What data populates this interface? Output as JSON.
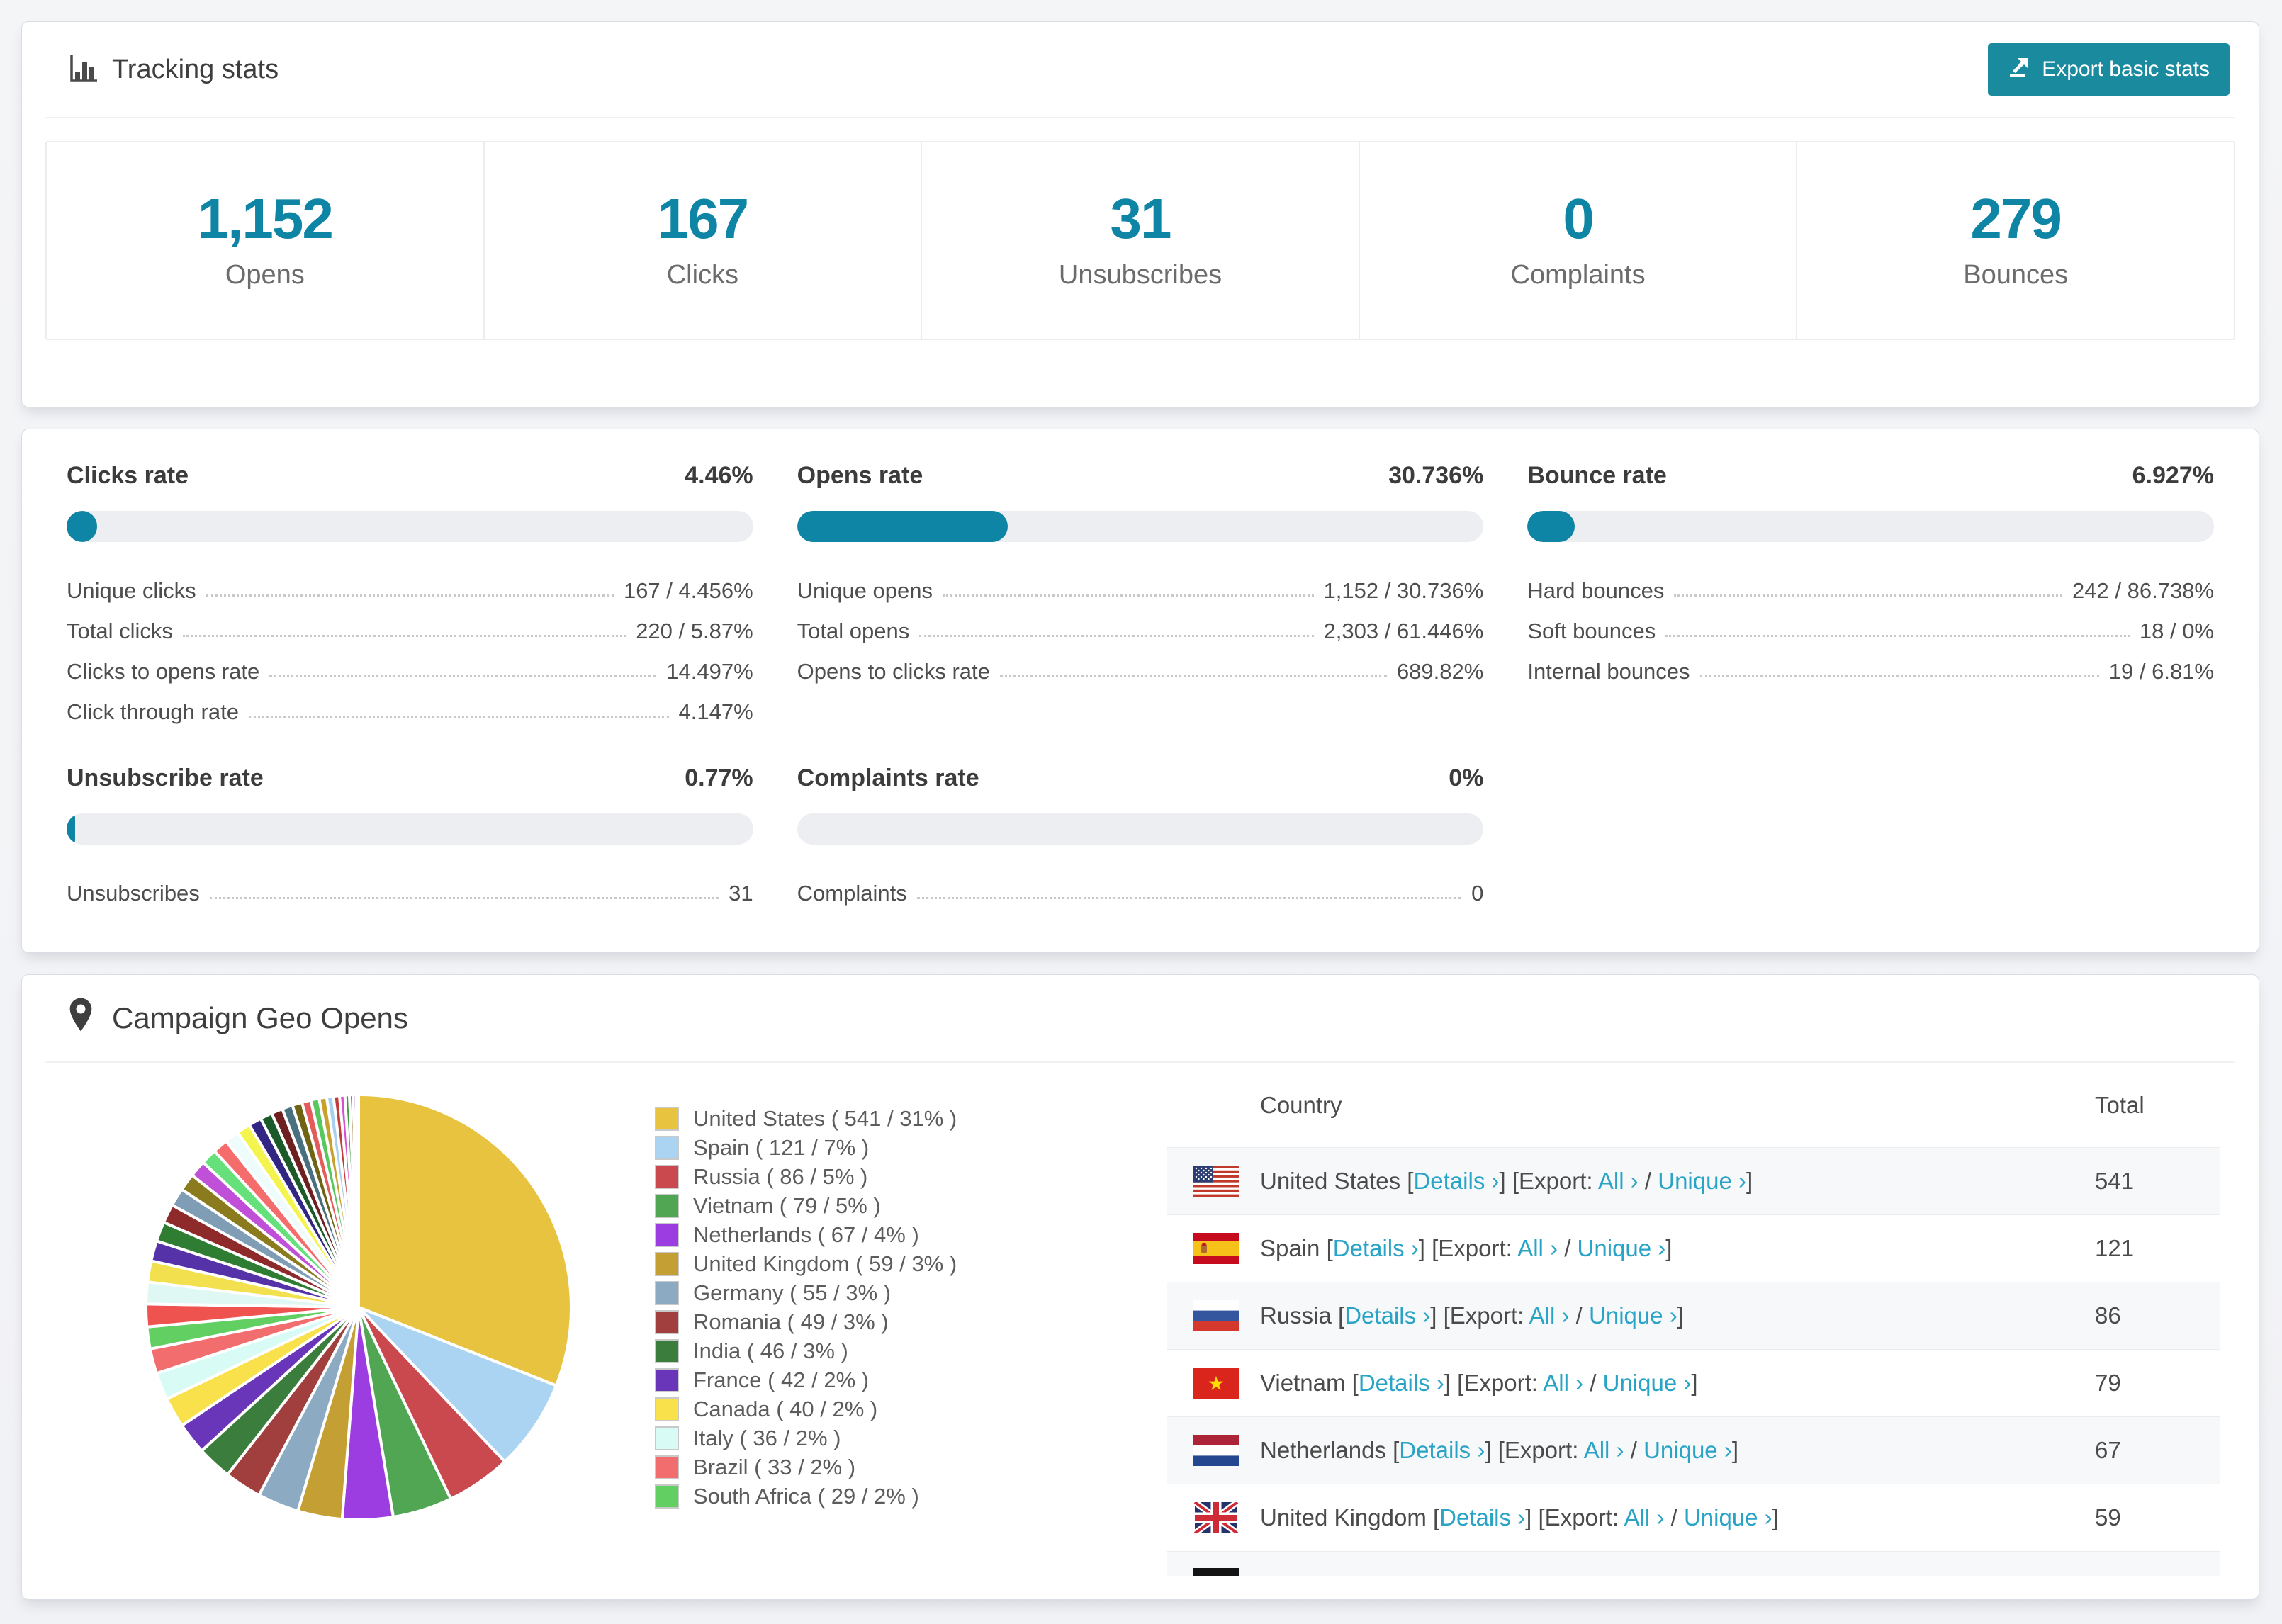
{
  "colors": {
    "accent": "#0f85a6",
    "button": "#1a8a9f",
    "link": "#29a3c6",
    "bar_track": "#eceef1",
    "zebra": "#f7f8f9"
  },
  "tracking": {
    "title": "Tracking stats",
    "export_button": "Export basic stats",
    "stats": [
      {
        "value": "1,152",
        "label": "Opens"
      },
      {
        "value": "167",
        "label": "Clicks"
      },
      {
        "value": "31",
        "label": "Unsubscribes"
      },
      {
        "value": "0",
        "label": "Complaints"
      },
      {
        "value": "279",
        "label": "Bounces"
      }
    ]
  },
  "rates": [
    {
      "title": "Clicks rate",
      "value": "4.46%",
      "percent": 4.46,
      "rows": [
        {
          "label": "Unique clicks",
          "value": "167 / 4.456%"
        },
        {
          "label": "Total clicks",
          "value": "220 / 5.87%"
        },
        {
          "label": "Clicks to opens rate",
          "value": "14.497%"
        },
        {
          "label": "Click through rate",
          "value": "4.147%"
        }
      ]
    },
    {
      "title": "Opens rate",
      "value": "30.736%",
      "percent": 30.736,
      "rows": [
        {
          "label": "Unique opens",
          "value": "1,152 / 30.736%"
        },
        {
          "label": "Total opens",
          "value": "2,303 / 61.446%"
        },
        {
          "label": "Opens to clicks rate",
          "value": "689.82%"
        }
      ]
    },
    {
      "title": "Bounce rate",
      "value": "6.927%",
      "percent": 6.927,
      "rows": [
        {
          "label": "Hard bounces",
          "value": "242 / 86.738%"
        },
        {
          "label": "Soft bounces",
          "value": "18 / 0%"
        },
        {
          "label": "Internal bounces",
          "value": "19 / 6.81%"
        }
      ]
    },
    {
      "title": "Unsubscribe rate",
      "value": "0.77%",
      "percent": 0.77,
      "rows": [
        {
          "label": "Unsubscribes",
          "value": "31"
        }
      ]
    },
    {
      "title": "Complaints rate",
      "value": "0%",
      "percent": 0,
      "rows": [
        {
          "label": "Complaints",
          "value": "0"
        }
      ]
    }
  ],
  "geo": {
    "title": "Campaign Geo Opens",
    "table": {
      "columns": [
        "Country",
        "Total"
      ],
      "link_labels": {
        "details": "Details ›",
        "export": "Export:",
        "all": "All ›",
        "unique": "Unique ›"
      },
      "rows": [
        {
          "flag": "us",
          "country": "United States",
          "total": "541"
        },
        {
          "flag": "es",
          "country": "Spain",
          "total": "121"
        },
        {
          "flag": "ru",
          "country": "Russia",
          "total": "86"
        },
        {
          "flag": "vn",
          "country": "Vietnam",
          "total": "79"
        },
        {
          "flag": "nl",
          "country": "Netherlands",
          "total": "67"
        },
        {
          "flag": "gb",
          "country": "United Kingdom",
          "total": "59"
        }
      ],
      "clipped_row": {
        "flag": "de"
      }
    }
  },
  "chart_data": {
    "type": "pie",
    "title": "Campaign Geo Opens",
    "legend_position": "right",
    "start": "12-oclock-clockwise",
    "total": 1745,
    "series": [
      {
        "label": "United States",
        "value": 541,
        "pct": "31%",
        "color": "#e7c340"
      },
      {
        "label": "Spain",
        "value": 121,
        "pct": "7%",
        "color": "#abd3f2"
      },
      {
        "label": "Russia",
        "value": 86,
        "pct": "5%",
        "color": "#c9494e"
      },
      {
        "label": "Vietnam",
        "value": 79,
        "pct": "5%",
        "color": "#51a653"
      },
      {
        "label": "Netherlands",
        "value": 67,
        "pct": "4%",
        "color": "#9b3de0"
      },
      {
        "label": "United Kingdom",
        "value": 59,
        "pct": "3%",
        "color": "#c49f33"
      },
      {
        "label": "Germany",
        "value": 55,
        "pct": "3%",
        "color": "#8cabc3"
      },
      {
        "label": "Romania",
        "value": 49,
        "pct": "3%",
        "color": "#a03f3e"
      },
      {
        "label": "India",
        "value": 46,
        "pct": "3%",
        "color": "#3b7d3d"
      },
      {
        "label": "France",
        "value": 42,
        "pct": "2%",
        "color": "#6936b9"
      },
      {
        "label": "Canada",
        "value": 40,
        "pct": "2%",
        "color": "#f8e14b"
      },
      {
        "label": "Italy",
        "value": 36,
        "pct": "2%",
        "color": "#d9fbf6"
      },
      {
        "label": "Brazil",
        "value": 33,
        "pct": "2%",
        "color": "#f26d6d"
      },
      {
        "label": "South Africa",
        "value": 29,
        "pct": "2%",
        "color": "#62cf62"
      }
    ],
    "unlabeled_small_slices": [
      {
        "value": 30,
        "color": "#ef5350"
      },
      {
        "value": 29,
        "color": "#dff8f4"
      },
      {
        "value": 28,
        "color": "#f3e04e"
      },
      {
        "value": 27,
        "color": "#5632a8"
      },
      {
        "value": 26,
        "color": "#2e7d32"
      },
      {
        "value": 25,
        "color": "#8e2a2a"
      },
      {
        "value": 24,
        "color": "#7f9db5"
      },
      {
        "value": 23,
        "color": "#8a7b1f"
      },
      {
        "value": 22,
        "color": "#c050d8"
      },
      {
        "value": 21,
        "color": "#66e07a"
      },
      {
        "value": 20,
        "color": "#f56c6c"
      },
      {
        "value": 19,
        "color": "#eefcfb"
      },
      {
        "value": 18,
        "color": "#f4f44e"
      },
      {
        "value": 17,
        "color": "#312782"
      },
      {
        "value": 16,
        "color": "#1d5a2a"
      },
      {
        "value": 15,
        "color": "#6e1f1f"
      },
      {
        "value": 14,
        "color": "#49707f"
      },
      {
        "value": 13,
        "color": "#6e6414"
      },
      {
        "value": 12,
        "color": "#e45b5b"
      },
      {
        "value": 11,
        "color": "#58c85e"
      },
      {
        "value": 10,
        "color": "#c8a02c"
      },
      {
        "value": 9,
        "color": "#a8d0f0"
      },
      {
        "value": 8,
        "color": "#c23a3a"
      },
      {
        "value": 7,
        "color": "#d84fd0"
      },
      {
        "value": 6,
        "color": "#3a9d3a"
      },
      {
        "value": 5,
        "color": "#8a6a1a"
      },
      {
        "value": 4,
        "color": "#6a3ab8"
      },
      {
        "value": 2,
        "color": "#b8a832"
      },
      {
        "value": 1,
        "color": "#ff6f91"
      }
    ]
  }
}
